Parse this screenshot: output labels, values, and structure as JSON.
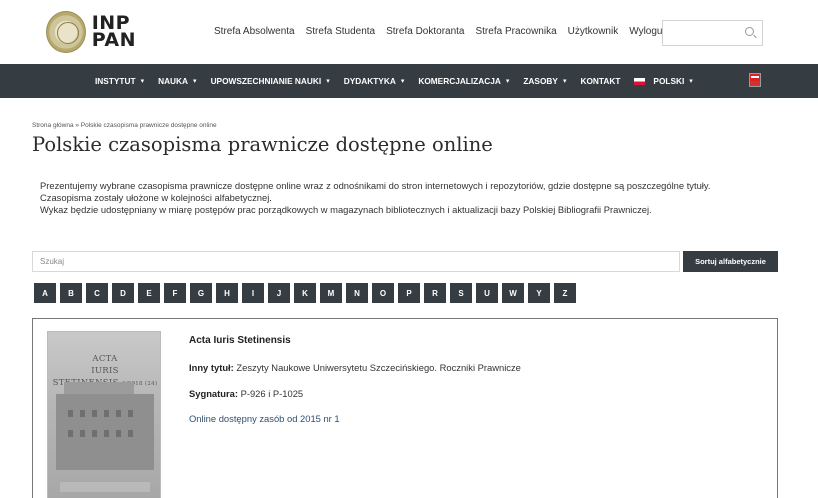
{
  "header": {
    "logo_text_line1": "INP",
    "logo_text_line2": "PAN",
    "links": [
      "Strefa Absolwenta",
      "Strefa Studenta",
      "Strefa Doktoranta",
      "Strefa Pracownika",
      "Użytkownik",
      "Wyloguj"
    ],
    "search_placeholder": ""
  },
  "nav": {
    "items": [
      {
        "label": "INSTYTUT",
        "caret": "▾"
      },
      {
        "label": "NAUKA",
        "caret": "▾"
      },
      {
        "label": "UPOWSZECHNIANIE NAUKI",
        "caret": "▾"
      },
      {
        "label": "DYDAKTYKA",
        "caret": "▾"
      },
      {
        "label": "KOMERCJALIZACJA",
        "caret": "▾"
      },
      {
        "label": "ZASOBY",
        "caret": "▾"
      },
      {
        "label": "KONTAKT",
        "caret": ""
      },
      {
        "label": "POLSKI",
        "caret": "▾"
      }
    ]
  },
  "page": {
    "breadcrumb": "Strona główna » Polskie czasopisma prawnicze dostępne online",
    "title": "Polskie czasopisma prawnicze dostępne online",
    "intro": [
      "Prezentujemy wybrane czasopisma prawnicze dostępne online wraz z odnośnikami do stron internetowych i repozytoriów, gdzie dostępne są poszczególne tytuły.",
      "Czasopisma zostały ułożone w kolejności alfabetycznej.",
      "Wykaz będzie udostępniany w miarę postępów prac porządkowych w magazynach bibliotecznych i aktualizacji bazy Polskiej Bibliografii Prawniczej."
    ],
    "filter_placeholder": "Szukaj",
    "sort_button": "Sortuj alfabetycznie",
    "letters": [
      "A",
      "B",
      "C",
      "D",
      "E",
      "F",
      "G",
      "H",
      "I",
      "J",
      "K",
      "M",
      "N",
      "O",
      "P",
      "R",
      "S",
      "U",
      "W",
      "Y",
      "Z"
    ]
  },
  "journal": {
    "title": "Acta Iuris Stetinensis",
    "other_title_label": "Inny tytuł:",
    "other_title": "Zeszyty Naukowe Uniwersytetu Szczecińskiego. Roczniki Prawnicze",
    "signature_label": "Sygnatura:",
    "signature": "P-926 i P-1025",
    "online_link": "Online dostępny zasób od 2015 nr 1",
    "cover_line1": "ACTA",
    "cover_line2": "IURIS",
    "cover_line3": "STETINENSIS",
    "cover_issue": "4/2018 (24)"
  }
}
